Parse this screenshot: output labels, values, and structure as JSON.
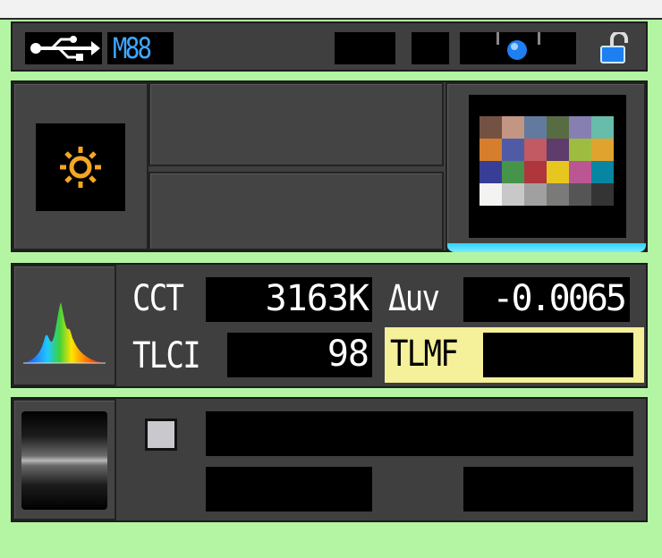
{
  "header": {
    "mode_badge": "M88",
    "icons": [
      "usb-icon",
      "lock-open-icon",
      "slider-indicator-icon"
    ]
  },
  "light_source": {
    "icon": "sun-icon",
    "accent_color": "#f5a623"
  },
  "color_chart": {
    "icon": "color-checker-icon",
    "swatches": [
      "#735244",
      "#c29682",
      "#627a9d",
      "#576c43",
      "#8580b1",
      "#67bdaa",
      "#d67e2c",
      "#505ba6",
      "#c15a63",
      "#5e3c6c",
      "#9dbc40",
      "#e0a32e",
      "#383d96",
      "#469449",
      "#af363c",
      "#e7c71f",
      "#bb5695",
      "#0885a1",
      "#f3f3f2",
      "#c8c8c8",
      "#a0a0a0",
      "#7a7a79",
      "#555555",
      "#343434"
    ]
  },
  "measurements": {
    "cct_label": "CCT",
    "cct_value": "3163K",
    "duv_label": "Δuv",
    "duv_value": "-0.0065",
    "tlci_label": "TLCI",
    "tlci_value": "98",
    "tlmf_label": "TLMF",
    "tlmf_value": "",
    "tlmf_bg": "#f5f09a"
  },
  "spectrum": {
    "icon": "spectrum-icon"
  },
  "bottom": {
    "icon": "cylinder-icon",
    "checkbox_checked": false
  }
}
